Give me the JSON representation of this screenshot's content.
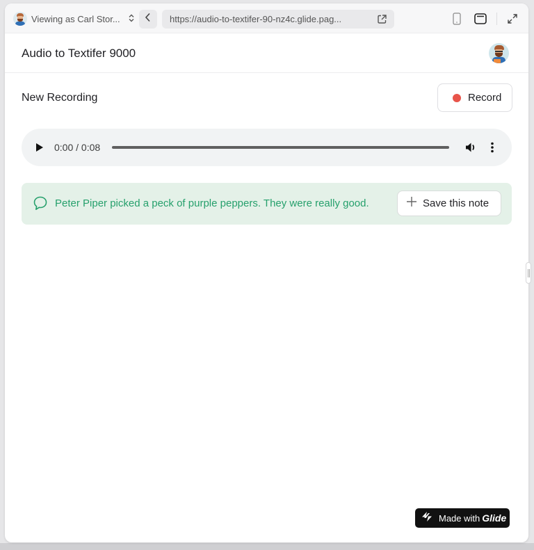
{
  "preview_bar": {
    "viewing_as": "Viewing as Carl Stor...",
    "url": "https://audio-to-textifer-90-nz4c.glide.pag..."
  },
  "app": {
    "title": "Audio to Textifer 9000"
  },
  "section": {
    "title": "New Recording",
    "record_label": "Record"
  },
  "audio_player": {
    "time": "0:00 / 0:08",
    "progress": 0
  },
  "note": {
    "text": "Peter Piper picked a peck of purple peppers. They were really good.",
    "save_label": "Save this note"
  },
  "badge": {
    "prefix": "Made with",
    "brand": "Glide"
  },
  "colors": {
    "record_dot": "#e8544a",
    "note_bg": "#e4f1e8",
    "note_text": "#26a06c",
    "badge_bg": "#111111"
  }
}
